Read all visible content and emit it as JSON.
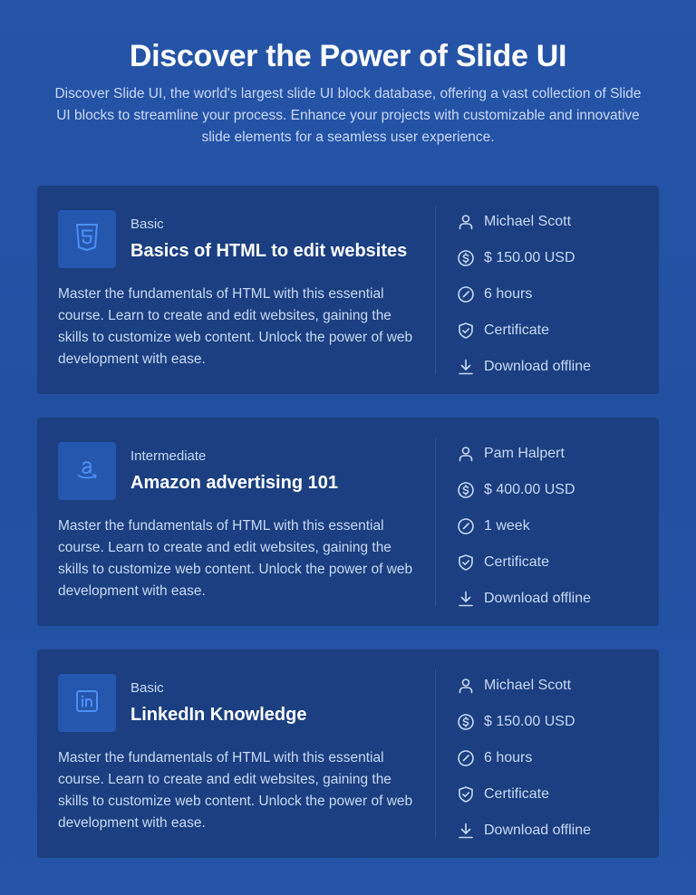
{
  "header": {
    "title": "Discover the Power of Slide UI",
    "subtitle": "Discover Slide UI, the world's largest slide UI block database, offering a vast collection of Slide UI blocks to streamline your process. Enhance your projects with customizable and innovative slide elements for a seamless user experience."
  },
  "courses": [
    {
      "level": "Basic",
      "title": "Basics of HTML to edit websites",
      "description": "Master the fundamentals of HTML with this essential course. Learn to create and edit websites, gaining the skills to customize web content. Unlock the power of web development with ease.",
      "logo_icon": "html5-icon",
      "instructor": "Michael Scott",
      "price": "$ 150.00 USD",
      "duration": "6 hours",
      "certificate": "Certificate",
      "download": "Download offline"
    },
    {
      "level": "Intermediate",
      "title": "Amazon advertising 101",
      "description": "Master the fundamentals of HTML with this essential course. Learn to create and edit websites, gaining the skills to customize web content. Unlock the power of web development with ease.",
      "logo_icon": "amazon-icon",
      "instructor": "Pam Halpert",
      "price": "$ 400.00 USD",
      "duration": "1 week",
      "certificate": "Certificate",
      "download": "Download offline"
    },
    {
      "level": "Basic",
      "title": "LinkedIn Knowledge",
      "description": "Master the fundamentals of HTML with this essential course. Learn to create and edit websites, gaining the skills to customize web content. Unlock the power of web development with ease.",
      "logo_icon": "linkedin-icon",
      "instructor": "Michael Scott",
      "price": "$ 150.00 USD",
      "duration": "6 hours",
      "certificate": "Certificate",
      "download": "Download offline"
    }
  ],
  "colors": {
    "background": "#2451a3",
    "card": "#1b3f80",
    "logo_box": "#2457ad",
    "text_muted": "#c9d8f5",
    "icon_accent": "#4d8ff5"
  }
}
